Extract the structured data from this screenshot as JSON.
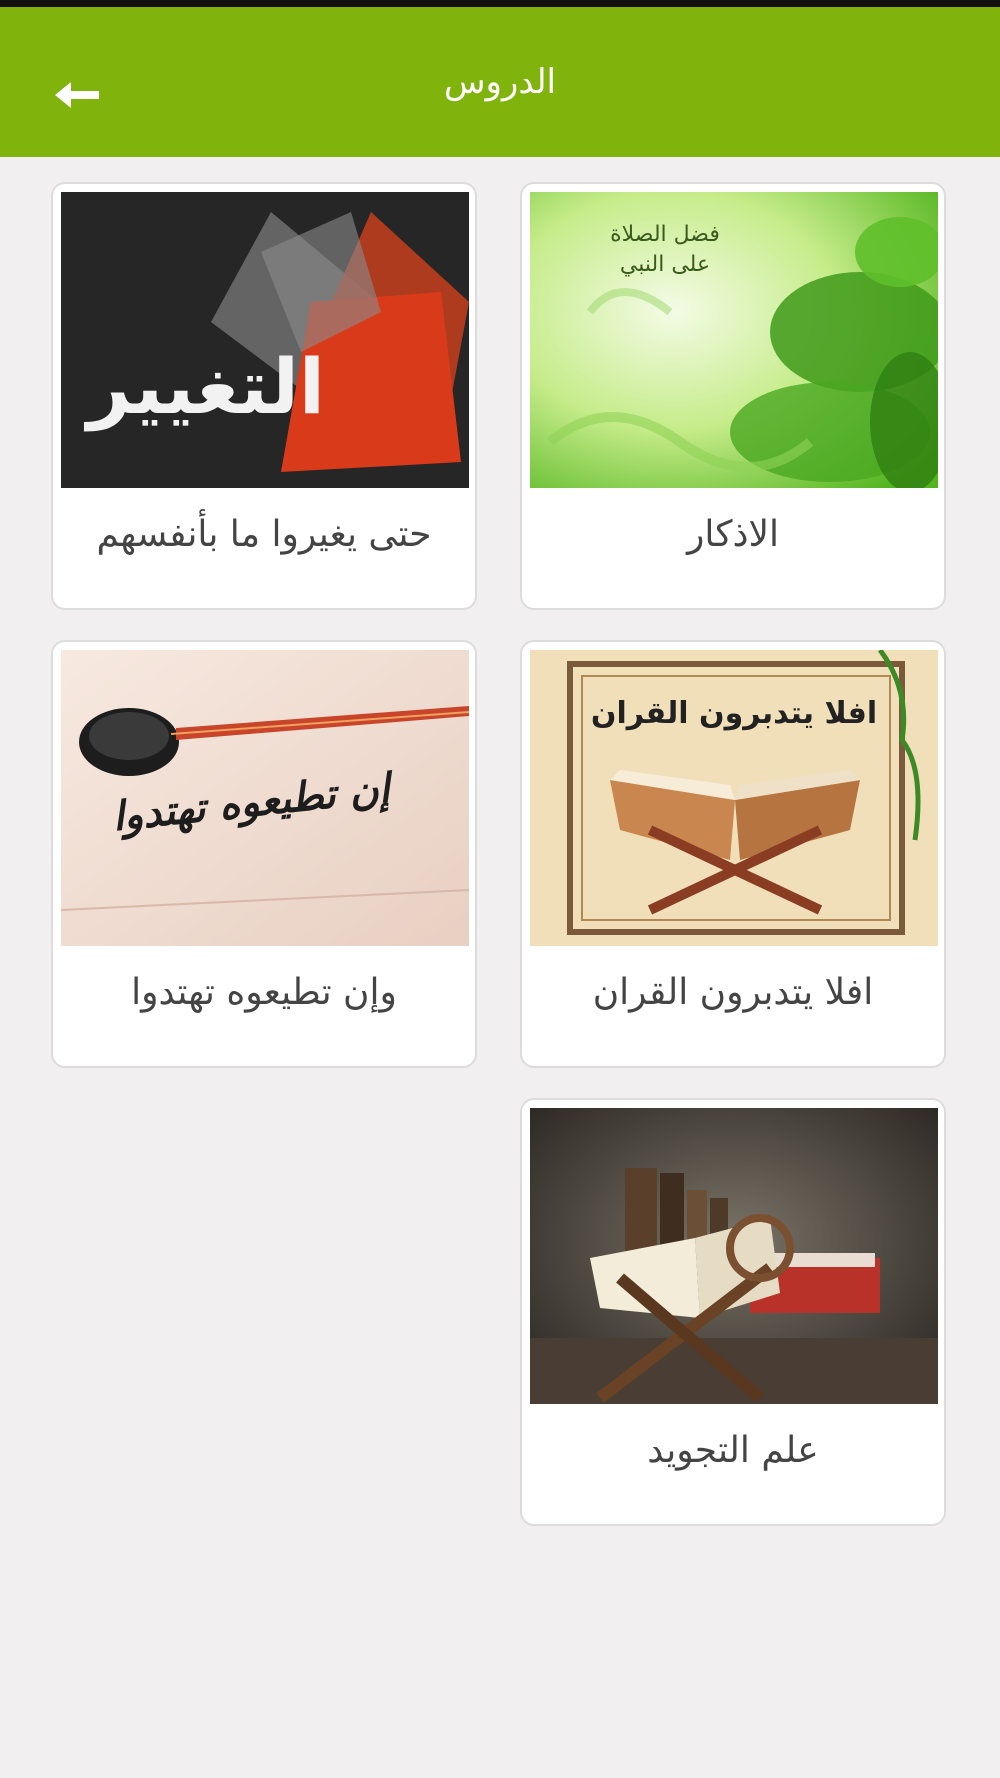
{
  "appbar": {
    "title": "الدروس",
    "back_icon": "arrow-left-icon"
  },
  "lessons": [
    {
      "label": "الاذكار",
      "image_icon": "greenery-calligraphy-image",
      "image_text_line1": "فضل الصلاة",
      "image_text_line2": "على النبي"
    },
    {
      "label": "حتى يغيروا ما بأنفسهم",
      "image_icon": "change-abstract-image",
      "image_text": "التغيير"
    },
    {
      "label": "افلا يتدبرون القران",
      "image_icon": "open-quran-stand-image",
      "image_text": "افلا يتدبرون القران"
    },
    {
      "label": "وإن تطيعوه تهتدوا",
      "image_icon": "calligraphy-pen-image",
      "image_text": "إن تطيعوه تهتدوا"
    },
    {
      "label": "علم التجويد",
      "image_icon": "books-quran-stand-image"
    }
  ],
  "colors": {
    "appbar": "#80b30c",
    "background": "#f1eff0",
    "card_border": "#dcdcdc",
    "label_text": "#444444"
  }
}
